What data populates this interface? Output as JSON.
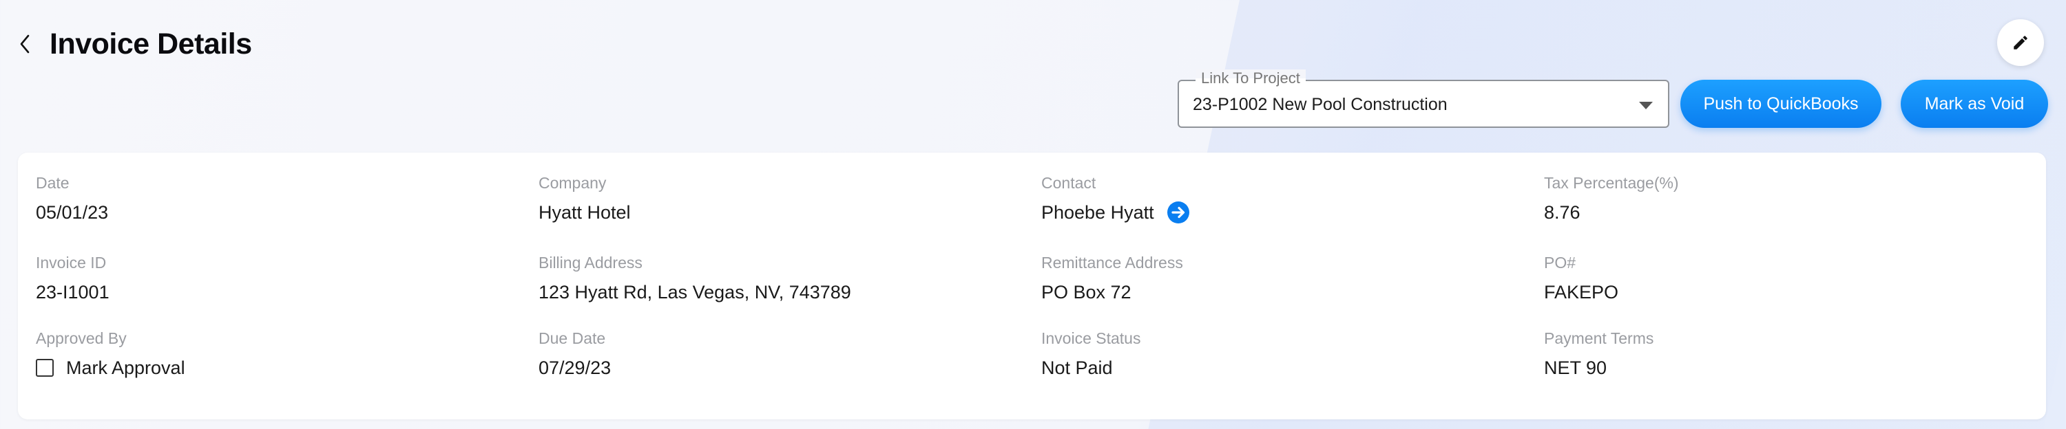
{
  "header": {
    "title": "Invoice Details"
  },
  "project_link": {
    "label": "Link To Project",
    "value": "23-P1002 New Pool Construction"
  },
  "actions": {
    "push_qb": "Push to QuickBooks",
    "mark_void": "Mark as Void"
  },
  "details": {
    "date": {
      "label": "Date",
      "value": "05/01/23"
    },
    "company": {
      "label": "Company",
      "value": "Hyatt Hotel"
    },
    "contact": {
      "label": "Contact",
      "value": "Phoebe Hyatt"
    },
    "tax": {
      "label": "Tax Percentage(%)",
      "value": "8.76"
    },
    "invoice_id": {
      "label": "Invoice ID",
      "value": "23-I1001"
    },
    "billing_address": {
      "label": "Billing Address",
      "value": "123 Hyatt Rd, Las Vegas, NV, 743789"
    },
    "remittance_address": {
      "label": "Remittance Address",
      "value": "PO Box 72"
    },
    "po": {
      "label": "PO#",
      "value": "FAKEPO"
    },
    "approved_by": {
      "label": "Approved By",
      "checkbox_label": "Mark Approval",
      "checked": false
    },
    "due_date": {
      "label": "Due Date",
      "value": "07/29/23"
    },
    "invoice_status": {
      "label": "Invoice Status",
      "value": "Not Paid"
    },
    "payment_terms": {
      "label": "Payment Terms",
      "value": "NET 90"
    }
  },
  "icons": {
    "back": "chevron-left-icon",
    "edit": "pencil-icon",
    "contact_link": "arrow-right-circle-icon",
    "dropdown": "caret-down-icon"
  },
  "colors": {
    "accent": "#0a7ef0",
    "label": "#9a9ca1",
    "text": "#1a1a1a"
  }
}
